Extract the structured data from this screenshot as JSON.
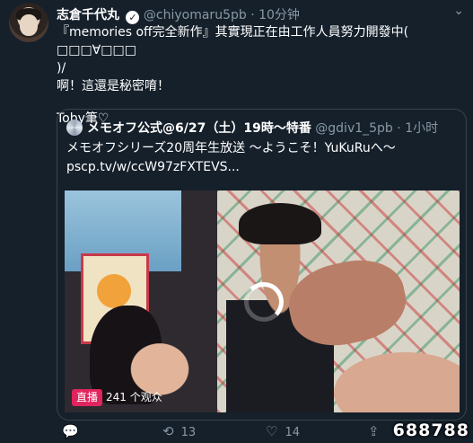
{
  "tweet": {
    "author_name": "志倉千代丸",
    "handle": "@chiyomaru5pb",
    "time": "10分钟",
    "lines": [
      "『memories off完全新作』其實現正在由工作人員努力開發中( □□□∀□□□",
      ")/",
      "啊！這還是秘密唷！",
      "",
      "Toby筆♡"
    ]
  },
  "quote": {
    "author_name": "メモオフ公式@6/27（土）19時～特番",
    "handle": "@gdiv1_5pb",
    "time": "1小时",
    "text_line1": "メモオフシリーズ20周年生放送 ～ようこそ！YuKuRuへ～",
    "text_line2": "pscp.tv/w/ccW97zFXTEVS...",
    "live_label": "直播",
    "viewers": "241 个观众"
  },
  "actions": {
    "retweets": "13",
    "likes": "14"
  },
  "watermark": "688788"
}
